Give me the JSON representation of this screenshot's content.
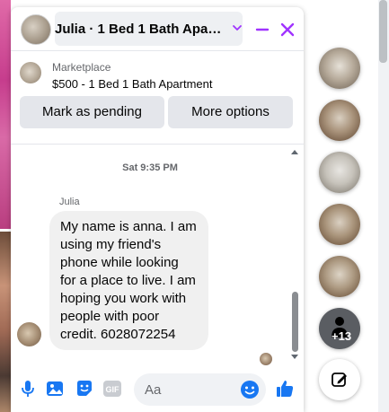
{
  "header": {
    "title": "Julia · 1 Bed 1 Bath Apartm..."
  },
  "listing": {
    "source": "Marketplace",
    "title": "$500 - 1 Bed 1 Bath Apartment",
    "mark_pending_label": "Mark as pending",
    "more_options_label": "More options"
  },
  "conversation": {
    "timestamp": "Sat 9:35 PM",
    "sender": "Julia",
    "message": "My name is anna. I am using my friend's phone while looking for a place to live. I am hoping you work with people with poor credit. 6028072254"
  },
  "composer": {
    "placeholder": "Aa",
    "gif_label": "GIF"
  },
  "chat_heads": {
    "more_count": "+13"
  },
  "colors": {
    "accent": "#1877f2",
    "header_action": "#a033ff",
    "button_bg": "#e4e6eb"
  }
}
